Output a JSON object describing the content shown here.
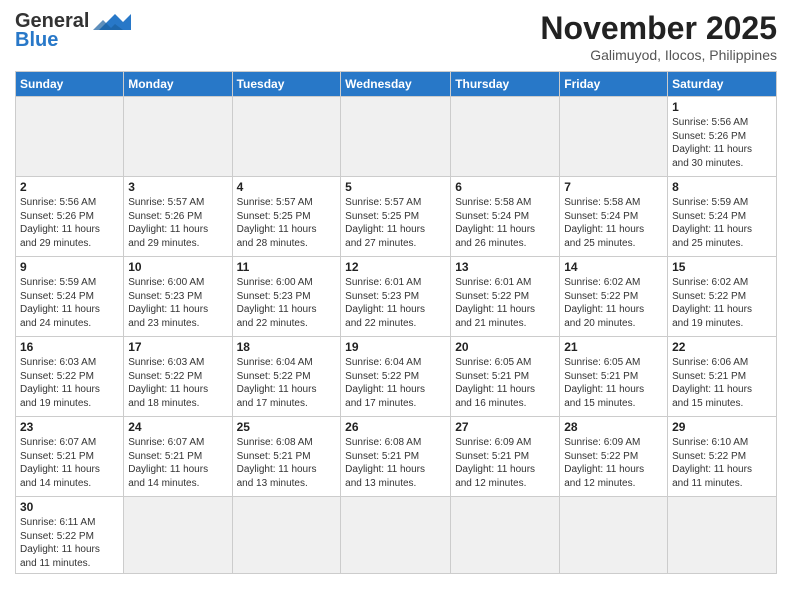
{
  "header": {
    "logo_general": "General",
    "logo_blue": "Blue",
    "month_year": "November 2025",
    "location": "Galimuyod, Ilocos, Philippines"
  },
  "weekdays": [
    "Sunday",
    "Monday",
    "Tuesday",
    "Wednesday",
    "Thursday",
    "Friday",
    "Saturday"
  ],
  "weeks": [
    [
      {
        "day": "",
        "info": ""
      },
      {
        "day": "",
        "info": ""
      },
      {
        "day": "",
        "info": ""
      },
      {
        "day": "",
        "info": ""
      },
      {
        "day": "",
        "info": ""
      },
      {
        "day": "",
        "info": ""
      },
      {
        "day": "1",
        "info": "Sunrise: 5:56 AM\nSunset: 5:26 PM\nDaylight: 11 hours\nand 30 minutes."
      }
    ],
    [
      {
        "day": "2",
        "info": "Sunrise: 5:56 AM\nSunset: 5:26 PM\nDaylight: 11 hours\nand 29 minutes."
      },
      {
        "day": "3",
        "info": "Sunrise: 5:57 AM\nSunset: 5:26 PM\nDaylight: 11 hours\nand 29 minutes."
      },
      {
        "day": "4",
        "info": "Sunrise: 5:57 AM\nSunset: 5:25 PM\nDaylight: 11 hours\nand 28 minutes."
      },
      {
        "day": "5",
        "info": "Sunrise: 5:57 AM\nSunset: 5:25 PM\nDaylight: 11 hours\nand 27 minutes."
      },
      {
        "day": "6",
        "info": "Sunrise: 5:58 AM\nSunset: 5:24 PM\nDaylight: 11 hours\nand 26 minutes."
      },
      {
        "day": "7",
        "info": "Sunrise: 5:58 AM\nSunset: 5:24 PM\nDaylight: 11 hours\nand 25 minutes."
      },
      {
        "day": "8",
        "info": "Sunrise: 5:59 AM\nSunset: 5:24 PM\nDaylight: 11 hours\nand 25 minutes."
      }
    ],
    [
      {
        "day": "9",
        "info": "Sunrise: 5:59 AM\nSunset: 5:24 PM\nDaylight: 11 hours\nand 24 minutes."
      },
      {
        "day": "10",
        "info": "Sunrise: 6:00 AM\nSunset: 5:23 PM\nDaylight: 11 hours\nand 23 minutes."
      },
      {
        "day": "11",
        "info": "Sunrise: 6:00 AM\nSunset: 5:23 PM\nDaylight: 11 hours\nand 22 minutes."
      },
      {
        "day": "12",
        "info": "Sunrise: 6:01 AM\nSunset: 5:23 PM\nDaylight: 11 hours\nand 22 minutes."
      },
      {
        "day": "13",
        "info": "Sunrise: 6:01 AM\nSunset: 5:22 PM\nDaylight: 11 hours\nand 21 minutes."
      },
      {
        "day": "14",
        "info": "Sunrise: 6:02 AM\nSunset: 5:22 PM\nDaylight: 11 hours\nand 20 minutes."
      },
      {
        "day": "15",
        "info": "Sunrise: 6:02 AM\nSunset: 5:22 PM\nDaylight: 11 hours\nand 19 minutes."
      }
    ],
    [
      {
        "day": "16",
        "info": "Sunrise: 6:03 AM\nSunset: 5:22 PM\nDaylight: 11 hours\nand 19 minutes."
      },
      {
        "day": "17",
        "info": "Sunrise: 6:03 AM\nSunset: 5:22 PM\nDaylight: 11 hours\nand 18 minutes."
      },
      {
        "day": "18",
        "info": "Sunrise: 6:04 AM\nSunset: 5:22 PM\nDaylight: 11 hours\nand 17 minutes."
      },
      {
        "day": "19",
        "info": "Sunrise: 6:04 AM\nSunset: 5:22 PM\nDaylight: 11 hours\nand 17 minutes."
      },
      {
        "day": "20",
        "info": "Sunrise: 6:05 AM\nSunset: 5:21 PM\nDaylight: 11 hours\nand 16 minutes."
      },
      {
        "day": "21",
        "info": "Sunrise: 6:05 AM\nSunset: 5:21 PM\nDaylight: 11 hours\nand 15 minutes."
      },
      {
        "day": "22",
        "info": "Sunrise: 6:06 AM\nSunset: 5:21 PM\nDaylight: 11 hours\nand 15 minutes."
      }
    ],
    [
      {
        "day": "23",
        "info": "Sunrise: 6:07 AM\nSunset: 5:21 PM\nDaylight: 11 hours\nand 14 minutes."
      },
      {
        "day": "24",
        "info": "Sunrise: 6:07 AM\nSunset: 5:21 PM\nDaylight: 11 hours\nand 14 minutes."
      },
      {
        "day": "25",
        "info": "Sunrise: 6:08 AM\nSunset: 5:21 PM\nDaylight: 11 hours\nand 13 minutes."
      },
      {
        "day": "26",
        "info": "Sunrise: 6:08 AM\nSunset: 5:21 PM\nDaylight: 11 hours\nand 13 minutes."
      },
      {
        "day": "27",
        "info": "Sunrise: 6:09 AM\nSunset: 5:21 PM\nDaylight: 11 hours\nand 12 minutes."
      },
      {
        "day": "28",
        "info": "Sunrise: 6:09 AM\nSunset: 5:22 PM\nDaylight: 11 hours\nand 12 minutes."
      },
      {
        "day": "29",
        "info": "Sunrise: 6:10 AM\nSunset: 5:22 PM\nDaylight: 11 hours\nand 11 minutes."
      }
    ],
    [
      {
        "day": "30",
        "info": "Sunrise: 6:11 AM\nSunset: 5:22 PM\nDaylight: 11 hours\nand 11 minutes."
      },
      {
        "day": "",
        "info": ""
      },
      {
        "day": "",
        "info": ""
      },
      {
        "day": "",
        "info": ""
      },
      {
        "day": "",
        "info": ""
      },
      {
        "day": "",
        "info": ""
      },
      {
        "day": "",
        "info": ""
      }
    ]
  ]
}
